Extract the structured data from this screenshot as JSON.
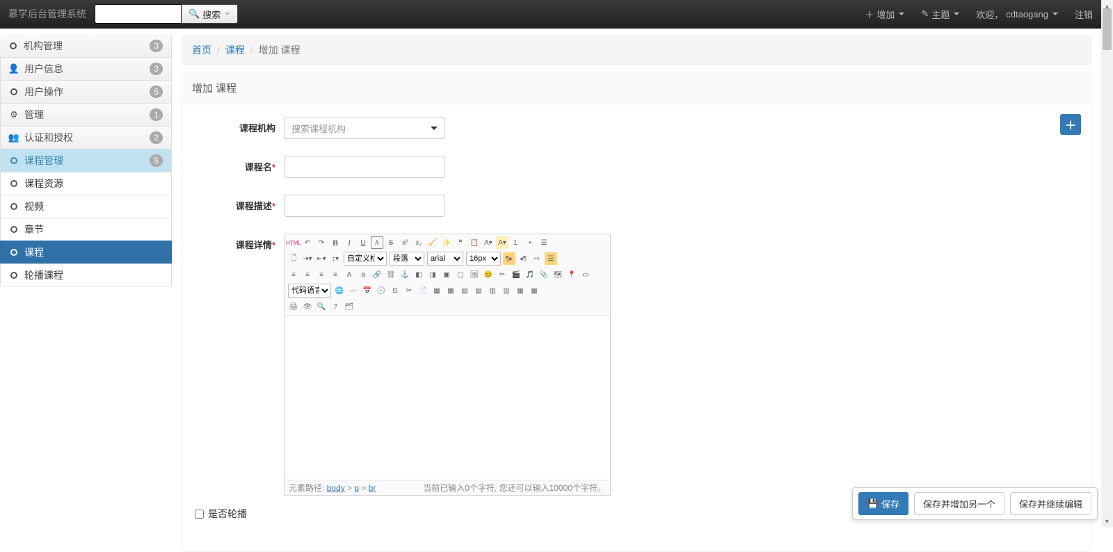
{
  "brand": "慕学后台管理系统",
  "search": {
    "placeholder": "",
    "button": "搜索",
    "caret": true
  },
  "topnav": {
    "add": "增加",
    "theme": "主题",
    "welcome_prefix": "欢迎，",
    "username": "cdtaogang",
    "logout": "注销"
  },
  "sidebar": {
    "groups": [
      {
        "icon": "circle",
        "label": "机构管理",
        "badge": "3"
      },
      {
        "icon": "user",
        "label": "用户信息",
        "badge": "3"
      },
      {
        "icon": "circle",
        "label": "用户操作",
        "badge": "5"
      },
      {
        "icon": "gear",
        "label": "管理",
        "badge": "1"
      },
      {
        "icon": "users",
        "label": "认证和授权",
        "badge": "2"
      },
      {
        "icon": "circle",
        "label": "课程管理",
        "badge": "5",
        "active": true,
        "children": [
          {
            "label": "课程资源"
          },
          {
            "label": "视频"
          },
          {
            "label": "章节"
          },
          {
            "label": "课程",
            "active": true
          },
          {
            "label": "轮播课程"
          }
        ]
      }
    ]
  },
  "breadcrumb": {
    "home": "首页",
    "module": "课程",
    "current": "增加 课程"
  },
  "panel": {
    "title": "增加 课程"
  },
  "form": {
    "org_label": "课程机构",
    "org_placeholder": "搜索课程机构",
    "name_label": "课程名",
    "desc_label": "课程描述",
    "detail_label": "课程详情",
    "banner_label": "是否轮播"
  },
  "editor": {
    "custom_title": "自定义标",
    "paragraph": "段落",
    "font": "arial",
    "size": "16px",
    "code_lang": "代码语言",
    "path_label": "元素路径:",
    "path_body": "body",
    "path_p": "p",
    "path_br": "br",
    "status": "当前已输入0个字符, 您还可以输入10000个字符。"
  },
  "buttons": {
    "save": "保存",
    "save_add": "保存并增加另一个",
    "save_continue": "保存并继续编辑"
  }
}
